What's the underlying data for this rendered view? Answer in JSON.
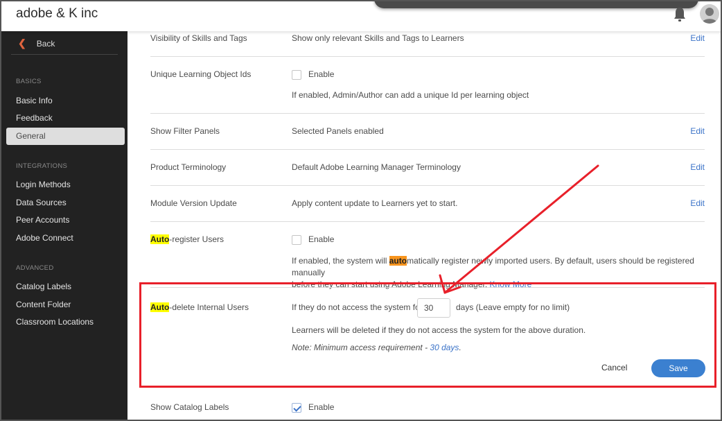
{
  "header": {
    "app_title": "adobe & K inc",
    "icons": [
      "bell-icon",
      "avatar-icon"
    ]
  },
  "sidebar": {
    "back_label": "Back",
    "sections": [
      {
        "heading": "BASICS",
        "items": [
          {
            "label": "Basic Info",
            "active": false
          },
          {
            "label": "Feedback",
            "active": false
          },
          {
            "label": "General",
            "active": true
          }
        ]
      },
      {
        "heading": "INTEGRATIONS",
        "items": [
          {
            "label": "Login Methods",
            "active": false
          },
          {
            "label": "Data Sources",
            "active": false
          },
          {
            "label": "Peer Accounts",
            "active": false
          },
          {
            "label": "Adobe Connect",
            "active": false
          }
        ]
      },
      {
        "heading": "ADVANCED",
        "items": [
          {
            "label": "Catalog Labels",
            "active": false
          },
          {
            "label": "Content Folder",
            "active": false
          },
          {
            "label": "Classroom Locations",
            "active": false
          }
        ]
      }
    ]
  },
  "settings": {
    "edit_label": "Edit",
    "enable_label": "Enable",
    "visibility_skills": {
      "label": "Visibility of Skills and Tags",
      "value": "Show only relevant Skills and Tags to Learners"
    },
    "unique_ids": {
      "label": "Unique Learning Object Ids",
      "checked": false,
      "description": "If enabled, Admin/Author can add a unique Id per learning object"
    },
    "filter_panels": {
      "label": "Show Filter Panels",
      "value": "Selected Panels enabled"
    },
    "product_terminology": {
      "label": "Product Terminology",
      "value": "Default Adobe Learning Manager Terminology"
    },
    "module_version": {
      "label": "Module Version Update",
      "value": "Apply content update to Learners yet to start."
    },
    "auto_register": {
      "label_highlight": "Auto",
      "label_rest": "-register Users",
      "checked": false,
      "desc_pre": "If enabled, the system will ",
      "desc_highlight": "auto",
      "desc_post": "matically register newly imported users. By default, users should be registered manually",
      "desc_line2": "before they can start using Adobe Learning Manager.",
      "know_more": "Know More"
    },
    "auto_delete": {
      "label_highlight": "Auto",
      "label_rest": "-delete Internal Users",
      "prefix": "If they do not access the system for",
      "days_value": "30",
      "suffix": "days (Leave empty for no limit)",
      "description": "Learners will be deleted if they do not access the system for the above duration.",
      "note_prefix": "Note: Minimum access requirement - ",
      "note_link": "30 days",
      "note_suffix": ".",
      "cancel_label": "Cancel",
      "save_label": "Save"
    },
    "catalog_labels": {
      "label": "Show Catalog Labels",
      "checked": true
    }
  },
  "annotation": {
    "highlight_color": "#e8202a"
  }
}
